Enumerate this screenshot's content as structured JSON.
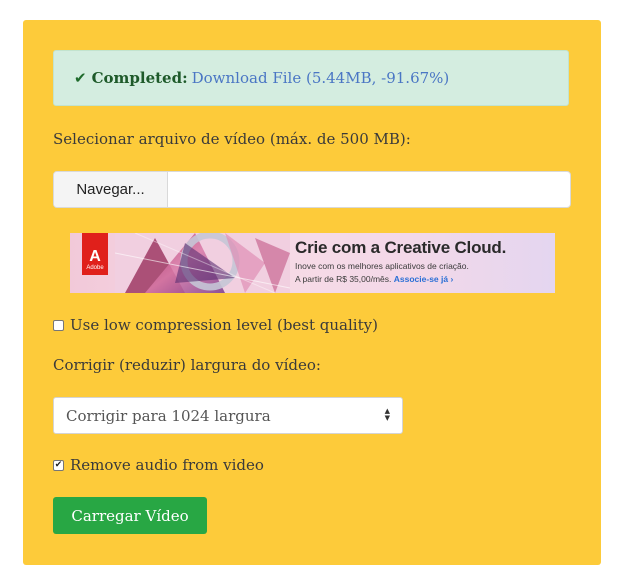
{
  "alert": {
    "status_label": "Completed:",
    "link_text": "Download File (5.44MB, -91.67%)",
    "icon": "check-icon",
    "color": "#d4ede0"
  },
  "file_upload": {
    "label": "Selecionar arquivo de vídeo (máx. de 500 MB):",
    "browse_label": "Navegar..."
  },
  "ad": {
    "brand": "Adobe",
    "title": "Crie com a Creative Cloud.",
    "subtitle": "Inove com os melhores aplicativos de criação.",
    "price_text": "A partir de R$ 35,00/mês.",
    "cta": "Associe-se já ›"
  },
  "options": {
    "low_compression_label": "Use low compression level (best quality)",
    "low_compression_checked": false,
    "width_label": "Corrigir (reduzir) largura do vídeo:",
    "width_select_value": "Corrigir para 1024 largura",
    "remove_audio_label": "Remove audio from video",
    "remove_audio_checked": true
  },
  "submit": {
    "label": "Carregar Vídeo",
    "color": "#28a744"
  },
  "theme": {
    "panel_color": "#fdcb3a"
  }
}
